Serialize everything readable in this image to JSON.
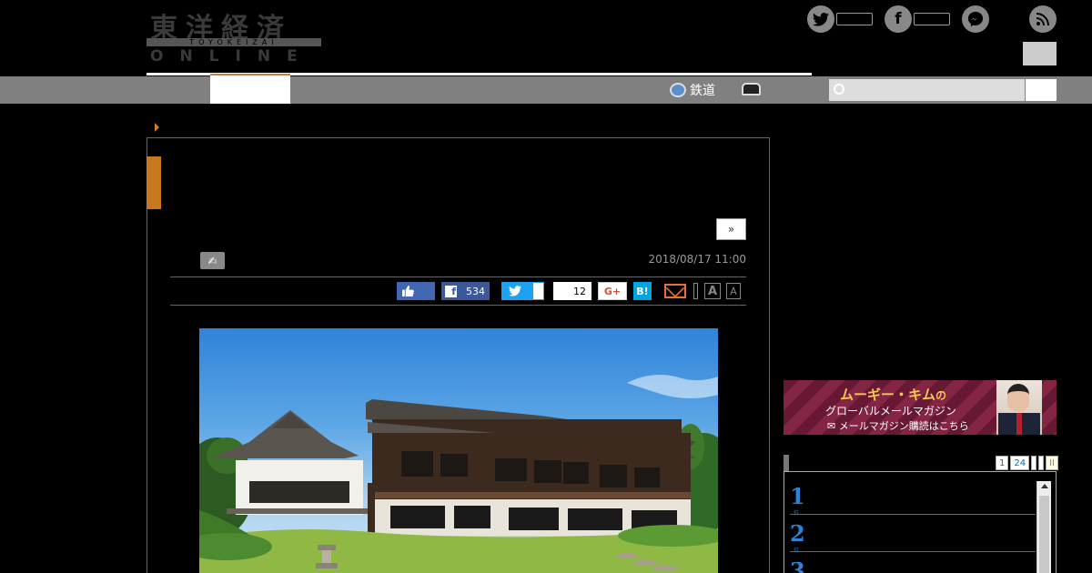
{
  "header": {
    "logo": {
      "kanji": "東洋経済",
      "roman": "TOYOKEIZAI",
      "online": "ONLINE"
    },
    "social_icons": [
      "twitter-icon",
      "facebook-icon",
      "messenger-icon",
      "rss-icon"
    ]
  },
  "nav": {
    "rail_label": "鉄道",
    "search": {
      "placeholder": ""
    }
  },
  "article": {
    "next_label": "»",
    "date": "2018/08/17 11:00",
    "share": {
      "facebook_count": "534",
      "pocket_count": "12",
      "gplus_label": "G+",
      "hatena_label": "B!",
      "font_large": "A",
      "font_small": "A"
    }
  },
  "sidebar": {
    "banner": {
      "line1": "ムーギー・キム",
      "line1_suffix": "の",
      "line2": "グローバルメールマガジン",
      "line3": "メールマガジン購読はこちら"
    },
    "ranking": {
      "tabs": [
        "1",
        "24"
      ],
      "items": [
        {
          "rank": "1",
          "suffix": "位"
        },
        {
          "rank": "2",
          "suffix": "位"
        },
        {
          "rank": "3",
          "suffix": "位"
        }
      ]
    }
  },
  "colors": {
    "accent_orange": "#c8781e",
    "nav_gray": "#808080",
    "rank_blue": "#2e83d6"
  }
}
